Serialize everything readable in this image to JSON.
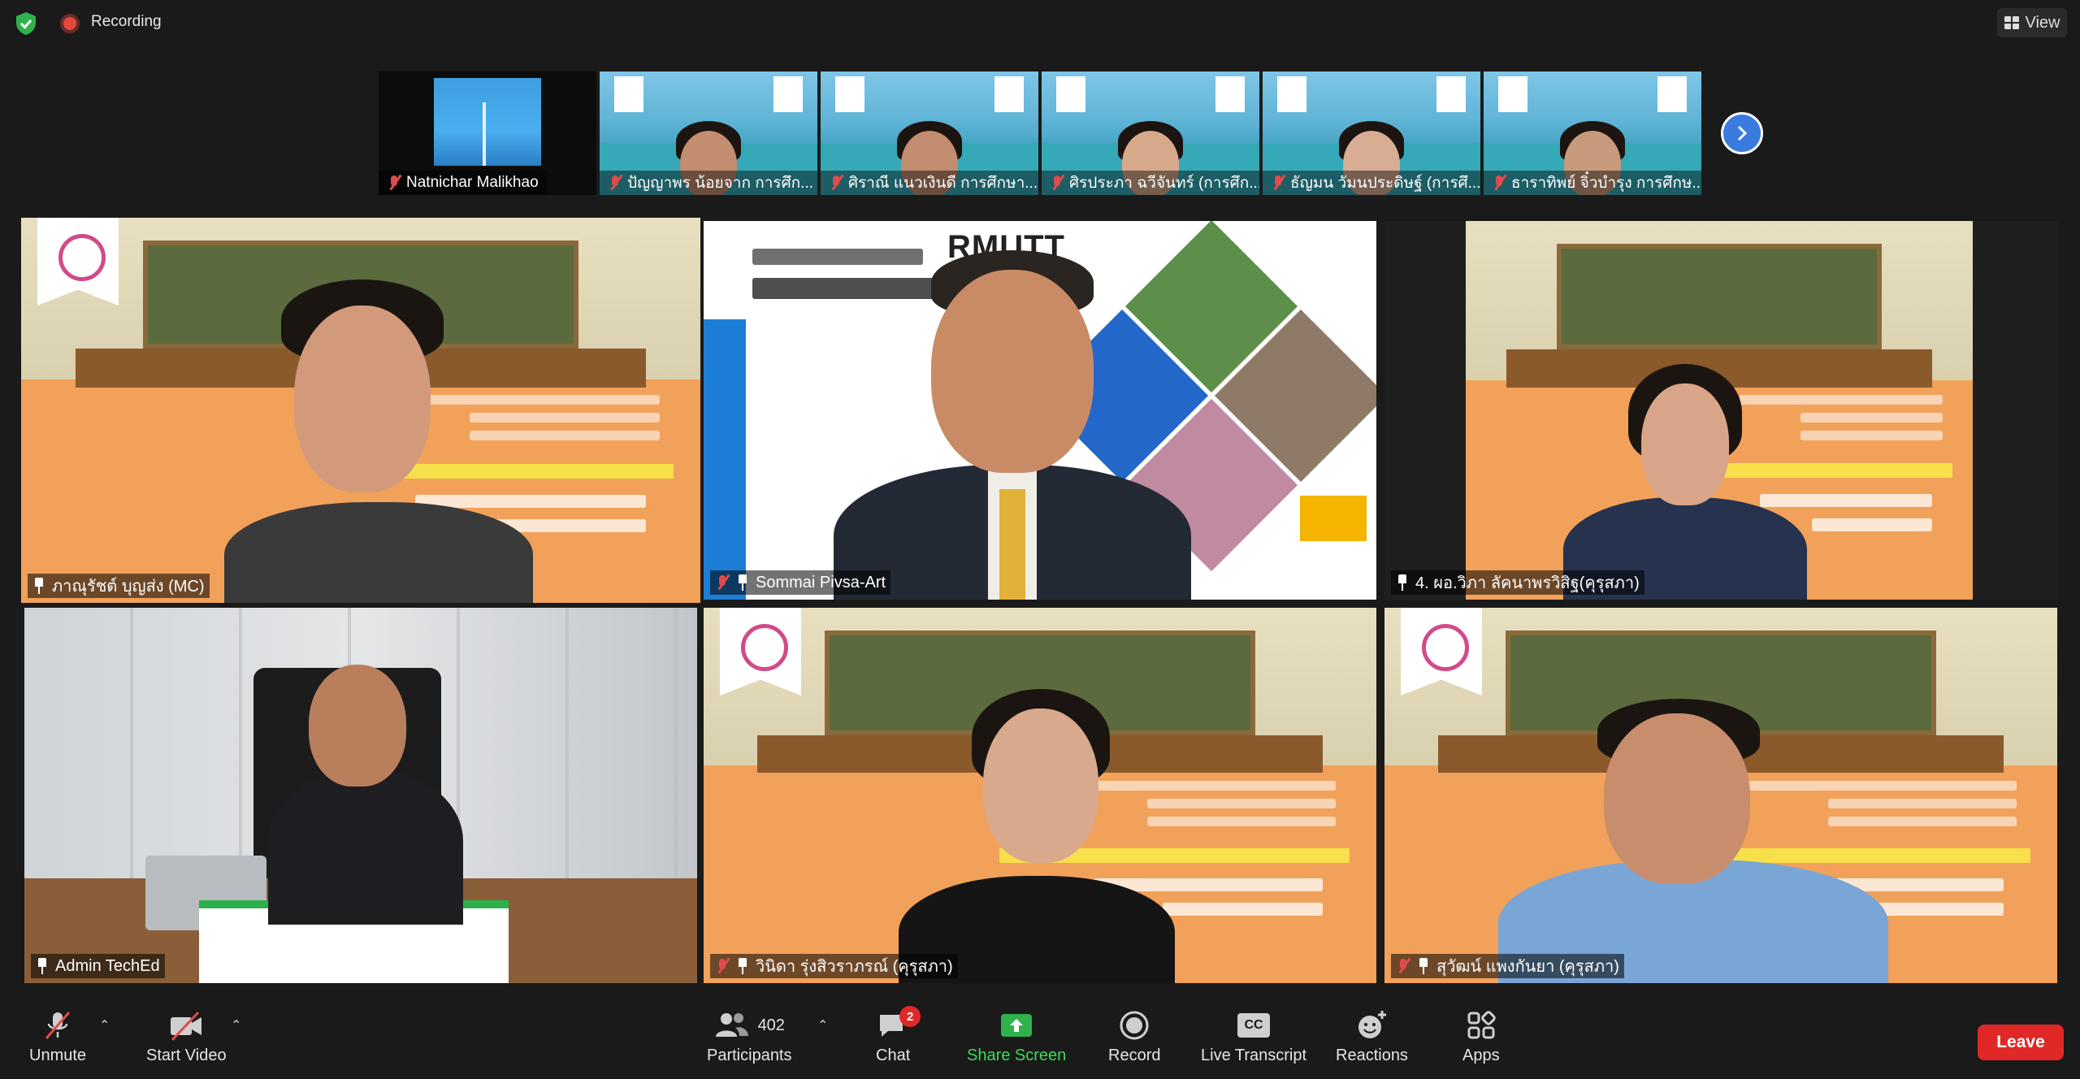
{
  "top_bar": {
    "recording_label": "Recording",
    "view_label": "View"
  },
  "thumbnails": [
    {
      "name": "Natnichar Malikhao"
    },
    {
      "name": "ปัญญาพร น้อยจาก การศึก..."
    },
    {
      "name": "ศิราณี แนวเงินดี การศึกษา..."
    },
    {
      "name": "ศิรประภา ฉวีจันทร์ (การศึก..."
    },
    {
      "name": "ธัญมน วัมนประดิษฐ์ (การศึ..."
    },
    {
      "name": "ธาราทิพย์ จิ๋วบำรุง การศึกษ..."
    }
  ],
  "main_tiles": [
    {
      "name": "ภาณุรัชต์ บุญส่ง (MC)"
    },
    {
      "name": "Sommai Pivsa-Art",
      "brand": "RMUTT"
    },
    {
      "name": "4. ผอ.วิภา ลัคนาพรวิสิฐ(คุรุสภา)"
    },
    {
      "name": "Admin TechEd"
    },
    {
      "name": "วินิดา รุ่งสิวราภรณ์ (คุรุสภา)"
    },
    {
      "name": "สุวัฒน์ แพงกันยา (คุรุสภา)"
    }
  ],
  "toolbar": {
    "unmute": "Unmute",
    "start_video": "Start Video",
    "participants_label": "Participants",
    "participants_count": "402",
    "chat_label": "Chat",
    "chat_badge": "2",
    "share_label": "Share Screen",
    "record_label": "Record",
    "transcript_label": "Live Transcript",
    "transcript_icon_text": "CC",
    "reactions_label": "Reactions",
    "apps_label": "Apps",
    "leave_label": "Leave"
  },
  "colors": {
    "active_speaker_border": "#e2e55a",
    "leave": "#e02828",
    "share": "#3ddc5a",
    "muted": "#e04b4b"
  }
}
